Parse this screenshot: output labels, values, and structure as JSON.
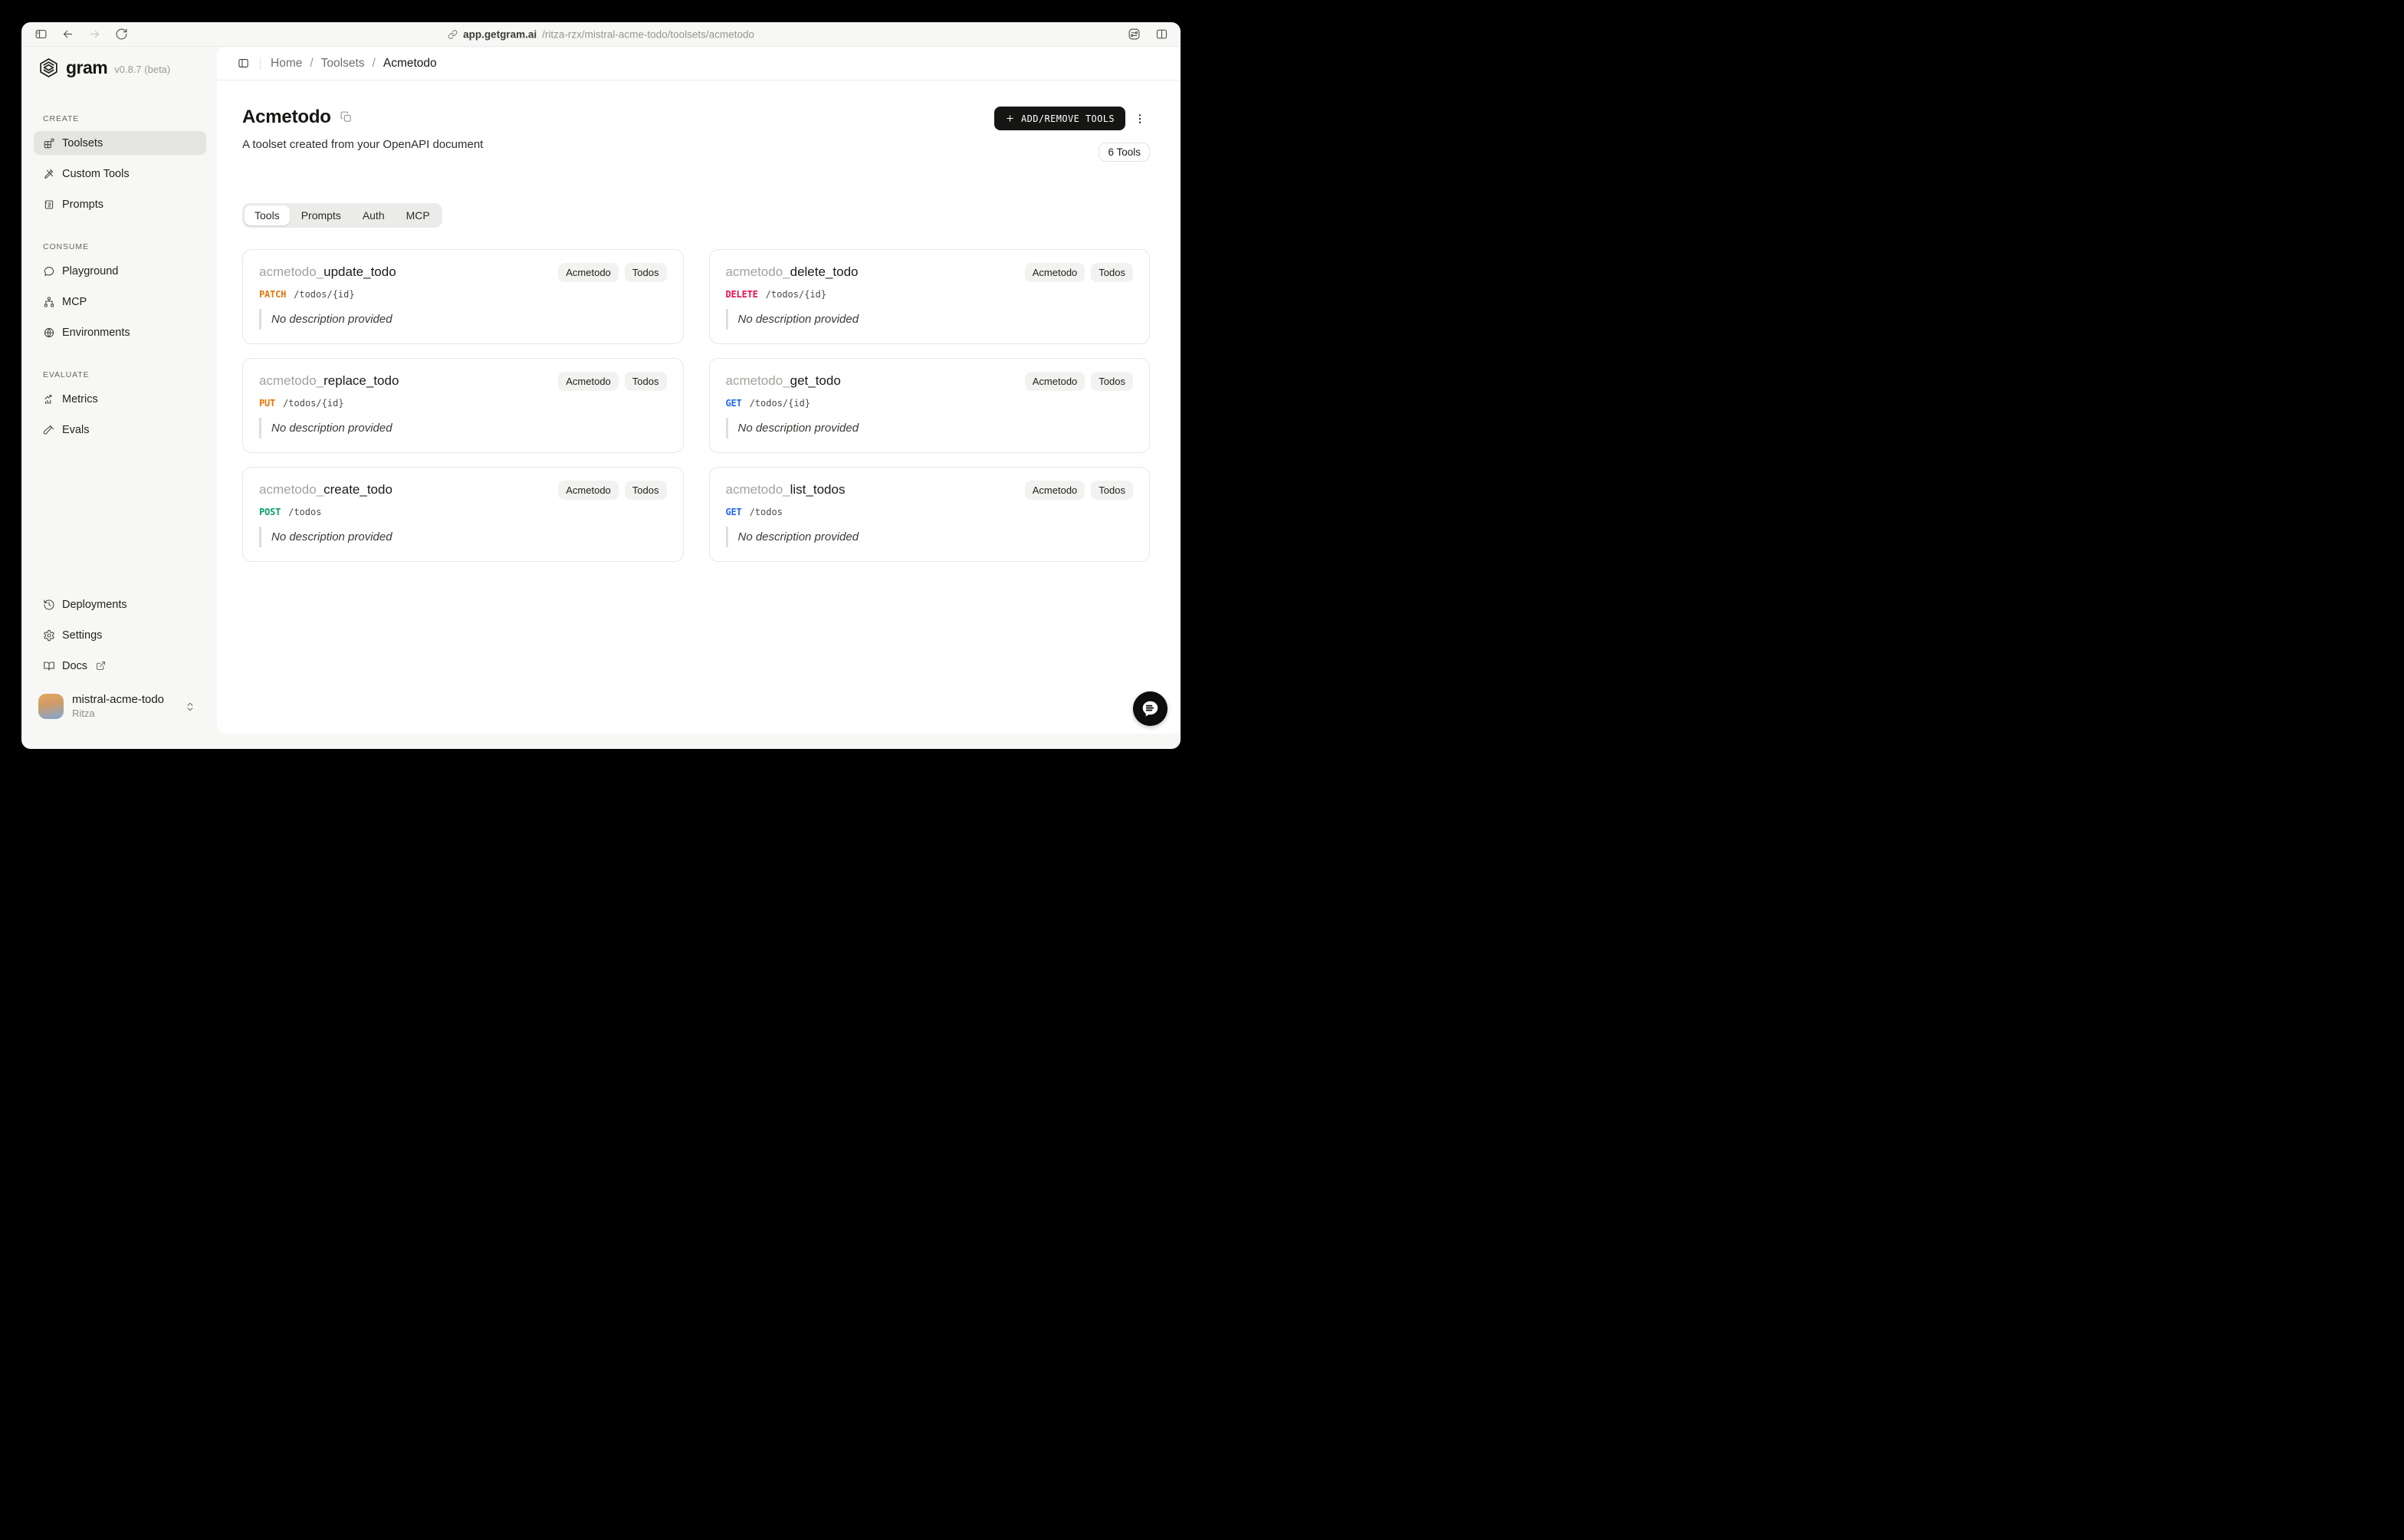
{
  "browser": {
    "url_host": "app.getgram.ai",
    "url_path": "/ritza-rzx/mistral-acme-todo/toolsets/acmetodo"
  },
  "sidebar": {
    "logo_text": "gram",
    "version": "v0.8.7 (beta)",
    "sections": [
      {
        "label": "CREATE",
        "items": [
          {
            "label": "Toolsets",
            "icon": "toolsets-icon",
            "active": true
          },
          {
            "label": "Custom Tools",
            "icon": "custom-tools-icon",
            "active": false
          },
          {
            "label": "Prompts",
            "icon": "prompts-icon",
            "active": false
          }
        ]
      },
      {
        "label": "CONSUME",
        "items": [
          {
            "label": "Playground",
            "icon": "playground-icon",
            "active": false
          },
          {
            "label": "MCP",
            "icon": "mcp-icon",
            "active": false
          },
          {
            "label": "Environments",
            "icon": "environments-icon",
            "active": false
          }
        ]
      },
      {
        "label": "EVALUATE",
        "items": [
          {
            "label": "Metrics",
            "icon": "metrics-icon",
            "active": false
          },
          {
            "label": "Evals",
            "icon": "evals-icon",
            "active": false
          }
        ]
      }
    ],
    "footer_items": [
      {
        "label": "Deployments",
        "icon": "deployments-icon"
      },
      {
        "label": "Settings",
        "icon": "settings-icon"
      },
      {
        "label": "Docs",
        "icon": "docs-icon",
        "external": true
      }
    ],
    "workspace": {
      "name": "mistral-acme-todo",
      "org": "Ritza"
    }
  },
  "breadcrumb": {
    "items": [
      "Home",
      "Toolsets",
      "Acmetodo"
    ]
  },
  "page": {
    "title": "Acmetodo",
    "subtitle": "A toolset created from your OpenAPI document",
    "add_remove_button": "ADD/REMOVE TOOLS",
    "tools_count_badge": "6 Tools",
    "tabs": [
      {
        "label": "Tools",
        "active": true
      },
      {
        "label": "Prompts",
        "active": false
      },
      {
        "label": "Auth",
        "active": false
      },
      {
        "label": "MCP",
        "active": false
      }
    ]
  },
  "method_colors": {
    "get": "#2469f0",
    "post": "#0a9f62",
    "put": "#e87409",
    "patch": "#e87409",
    "delete": "#e8134e"
  },
  "cards": [
    {
      "prefix": "acmetodo_",
      "name": "update_todo",
      "method": "PATCH",
      "method_color": "#e87409",
      "path": "/todos/{id}",
      "description": "No description provided",
      "badges": [
        "Acmetodo",
        "Todos"
      ]
    },
    {
      "prefix": "acmetodo_",
      "name": "delete_todo",
      "method": "DELETE",
      "method_color": "#e8134e",
      "path": "/todos/{id}",
      "description": "No description provided",
      "badges": [
        "Acmetodo",
        "Todos"
      ]
    },
    {
      "prefix": "acmetodo_",
      "name": "replace_todo",
      "method": "PUT",
      "method_color": "#e87409",
      "path": "/todos/{id}",
      "description": "No description provided",
      "badges": [
        "Acmetodo",
        "Todos"
      ]
    },
    {
      "prefix": "acmetodo_",
      "name": "get_todo",
      "method": "GET",
      "method_color": "#2469f0",
      "path": "/todos/{id}",
      "description": "No description provided",
      "badges": [
        "Acmetodo",
        "Todos"
      ]
    },
    {
      "prefix": "acmetodo_",
      "name": "create_todo",
      "method": "POST",
      "method_color": "#0a9f62",
      "path": "/todos",
      "description": "No description provided",
      "badges": [
        "Acmetodo",
        "Todos"
      ]
    },
    {
      "prefix": "acmetodo_",
      "name": "list_todos",
      "method": "GET",
      "method_color": "#2469f0",
      "path": "/todos",
      "description": "No description provided",
      "badges": [
        "Acmetodo",
        "Todos"
      ]
    }
  ]
}
